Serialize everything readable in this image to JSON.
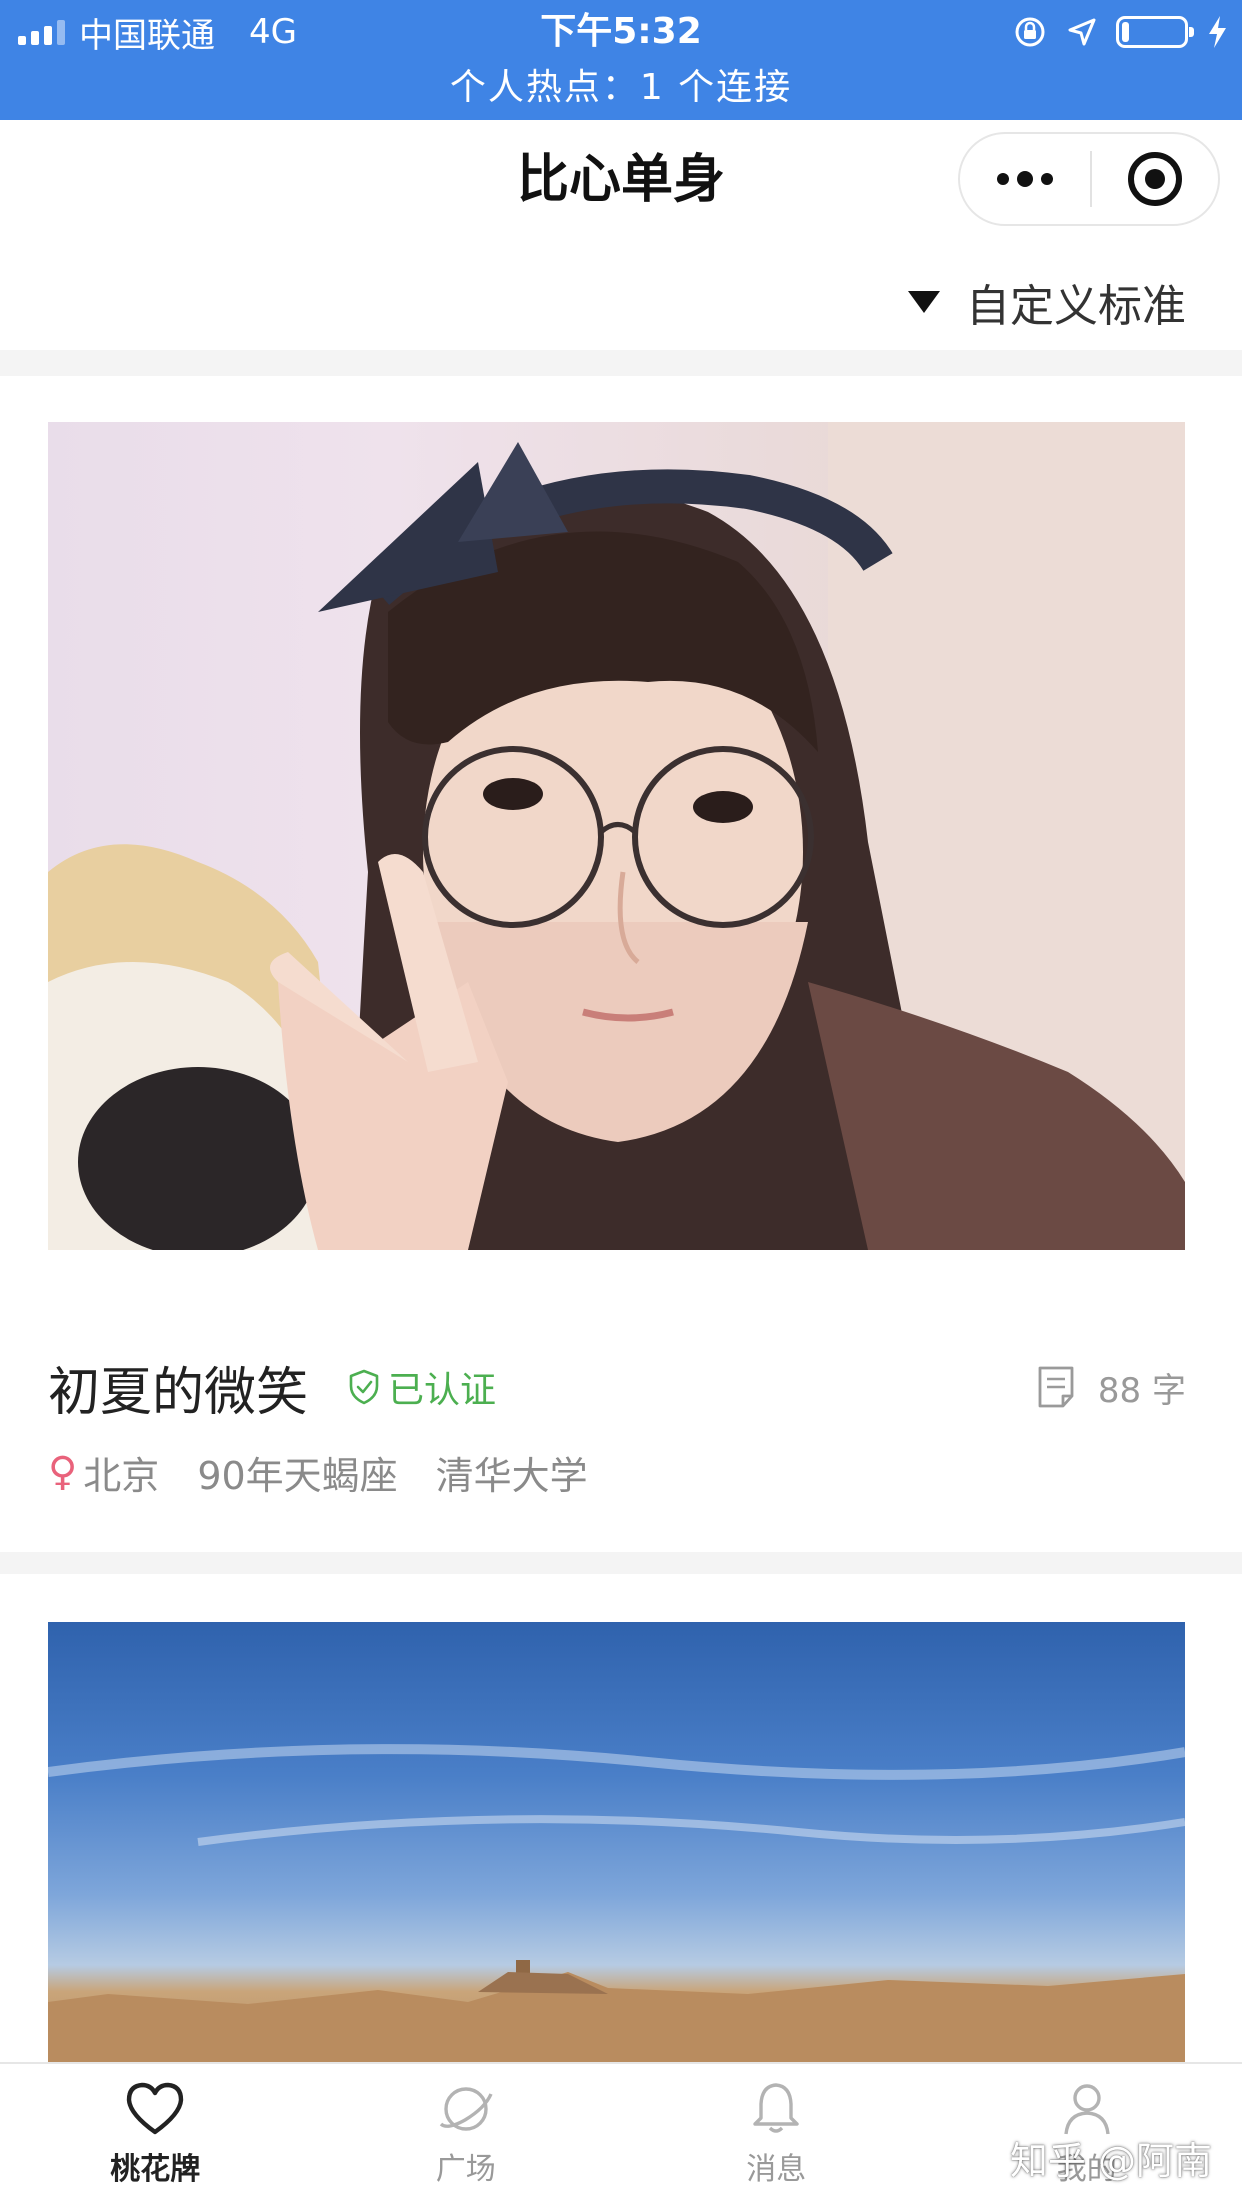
{
  "status_bar": {
    "carrier": "中国联通",
    "network": "4G",
    "time": "下午5:32",
    "hotspot": "个人热点：1 个连接",
    "battery_level": 0.12,
    "icons": [
      "signal-icon",
      "orientation-lock-icon",
      "location-icon",
      "battery-icon",
      "charging-icon"
    ]
  },
  "nav": {
    "title": "比心单身",
    "capsule_icons": [
      "more-dots-icon",
      "close-target-icon"
    ]
  },
  "filter": {
    "label": "自定义标准",
    "icon": "triangle-down-icon"
  },
  "cards": [
    {
      "nickname": "初夏的微笑",
      "verified_label": "已认证",
      "word_count": "88 字",
      "gender_icon": "female-icon",
      "city": "北京",
      "birth_sign": "90年天蝎座",
      "school": "清华大学",
      "photo": "selfie-photo"
    },
    {
      "photo": "desert-sky-photo"
    }
  ],
  "tabbar": {
    "tabs": [
      {
        "label": "桃花牌",
        "icon": "heart-icon",
        "active": true
      },
      {
        "label": "广场",
        "icon": "planet-icon",
        "active": false
      },
      {
        "label": "消息",
        "icon": "bell-icon",
        "active": false
      },
      {
        "label": "我的",
        "icon": "person-icon",
        "active": false
      }
    ]
  },
  "watermark": "知乎 @阿南",
  "colors": {
    "status_bar_bg": "#3f84e5",
    "verified_green": "#4caf50",
    "female_pink": "#e9627b"
  }
}
